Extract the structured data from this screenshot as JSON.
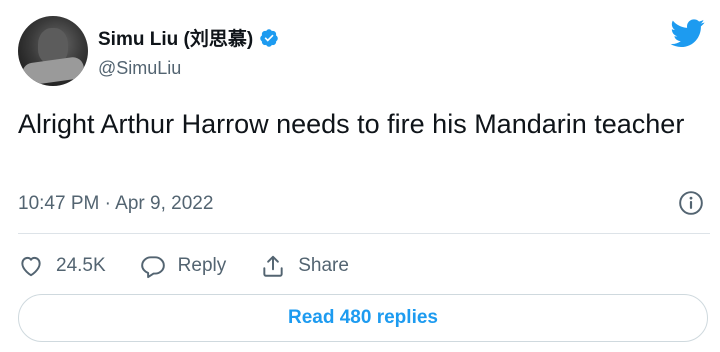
{
  "author": {
    "display_name": "Simu Liu (刘思慕)",
    "handle": "@SimuLiu",
    "verified": true,
    "avatar_icon": "avatar-photo"
  },
  "tweet": {
    "text": "Alright Arthur Harrow needs to fire his Mandarin teacher",
    "timestamp": "10:47 PM · Apr 9, 2022"
  },
  "actions": {
    "like_count": "24.5K",
    "reply_label": "Reply",
    "share_label": "Share"
  },
  "read_replies_label": "Read 480 replies",
  "icons": {
    "brand": "twitter-bird-icon",
    "verified": "verified-badge-icon",
    "info": "info-icon",
    "like": "heart-icon",
    "reply": "reply-bubble-icon",
    "share": "share-icon"
  },
  "colors": {
    "brand_blue": "#1d9bf0",
    "text_primary": "#0f1419",
    "text_secondary": "#536471",
    "divider": "#dde3e8"
  }
}
